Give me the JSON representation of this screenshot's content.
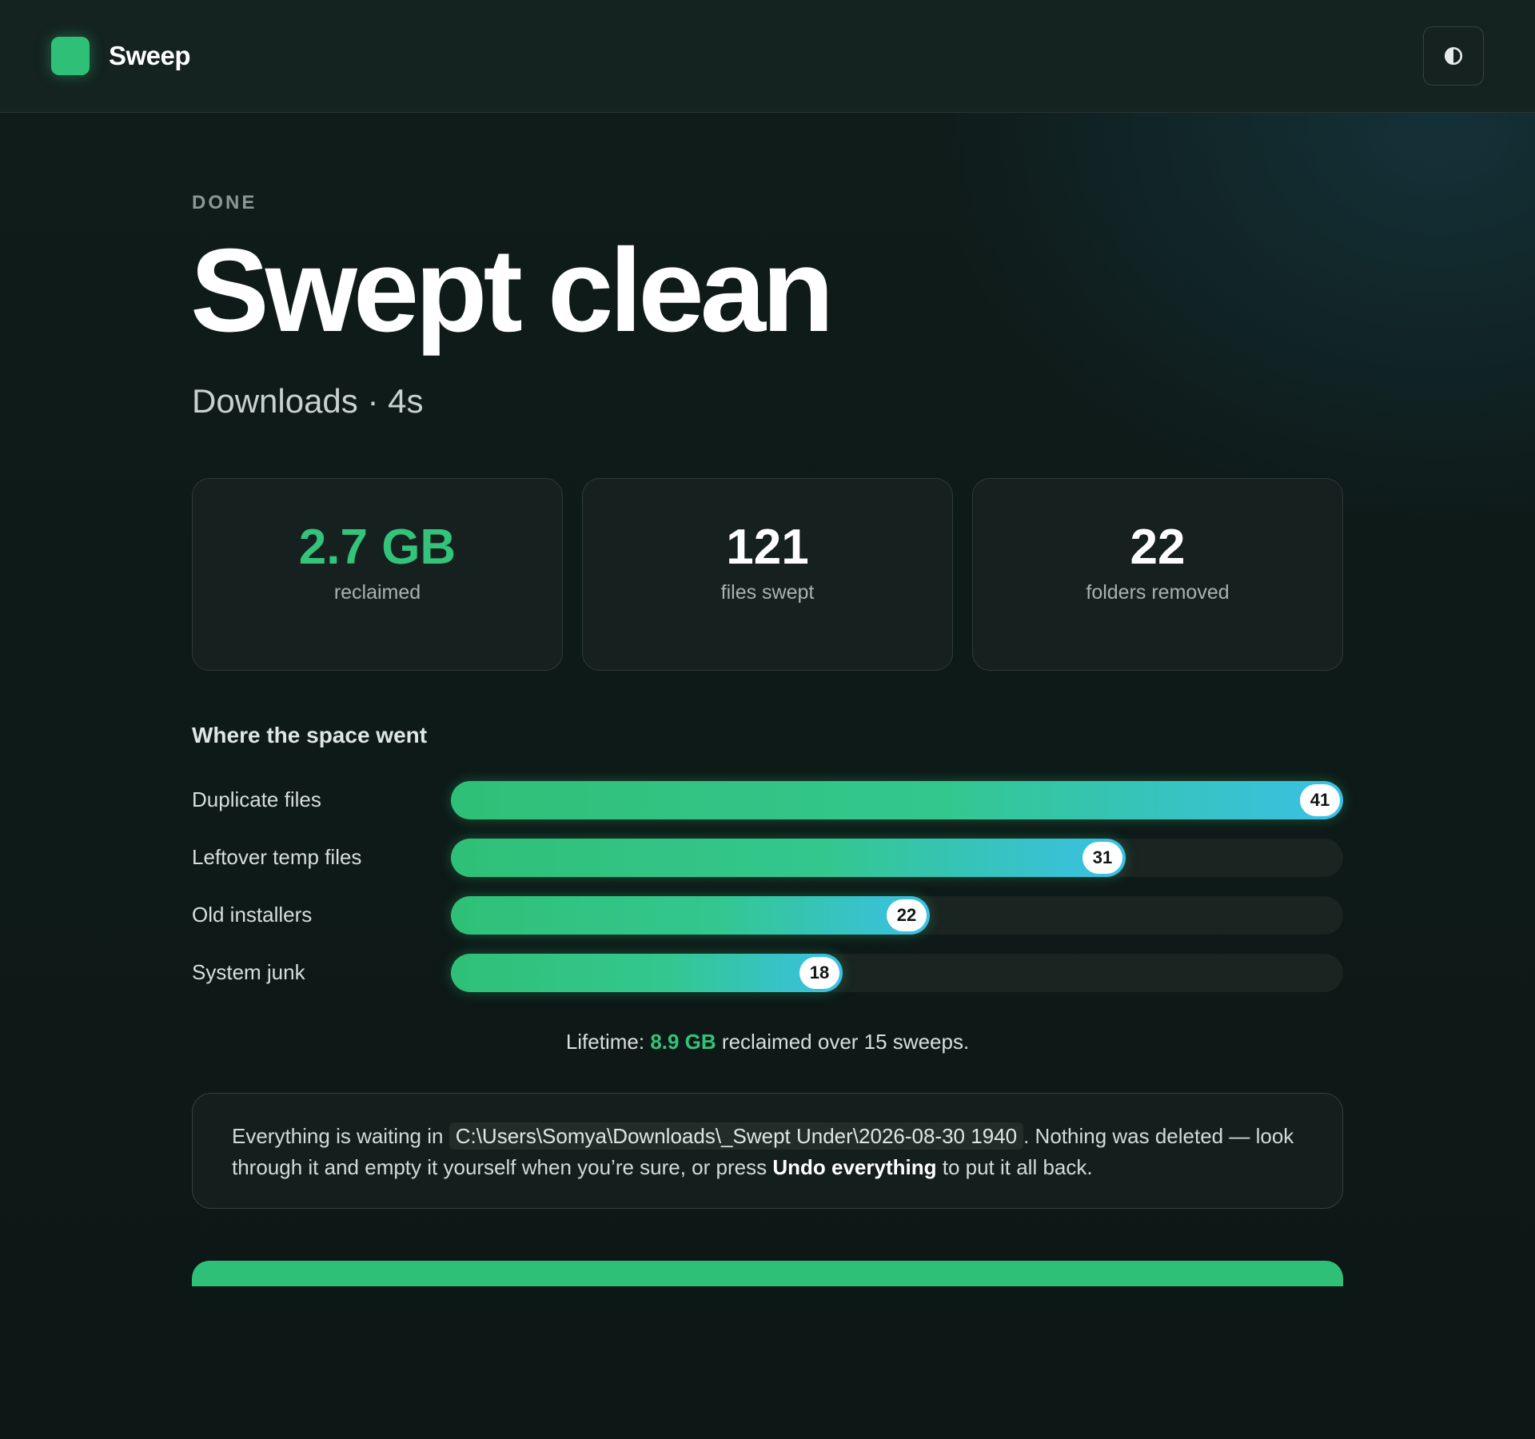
{
  "app": {
    "name": "Sweep",
    "theme_toggle_icon": "contrast-icon"
  },
  "header": {
    "eyebrow": "DONE",
    "title": "Swept clean",
    "subtitle": "Downloads · 4s"
  },
  "stats": [
    {
      "value": "2.7 GB",
      "label": "reclaimed"
    },
    {
      "value": "121",
      "label": "files swept"
    },
    {
      "value": "22",
      "label": "folders removed"
    }
  ],
  "breakdown": {
    "title": "Where the space went",
    "max": 41,
    "items": [
      {
        "label": "Duplicate files",
        "count": 41
      },
      {
        "label": "Leftover temp files",
        "count": 31
      },
      {
        "label": "Old installers",
        "count": 22
      },
      {
        "label": "System junk",
        "count": 18
      }
    ]
  },
  "lifetime": {
    "prefix": "Lifetime:",
    "amount": "8.9 GB",
    "suffix": "reclaimed over 15 sweeps."
  },
  "note": {
    "before_path": "Everything is waiting in",
    "path": "C:\\Users\\Somya\\Downloads\\_Swept Under\\2026-08-30 1940",
    "after_path": ". Nothing was deleted — look through it and empty it yourself when you’re sure, or press",
    "undo_label": "Undo everything",
    "end": "to put it all back."
  },
  "colors": {
    "accent": "#2fc077",
    "accent_end": "#3ac0e6",
    "background": "#0e1917"
  }
}
